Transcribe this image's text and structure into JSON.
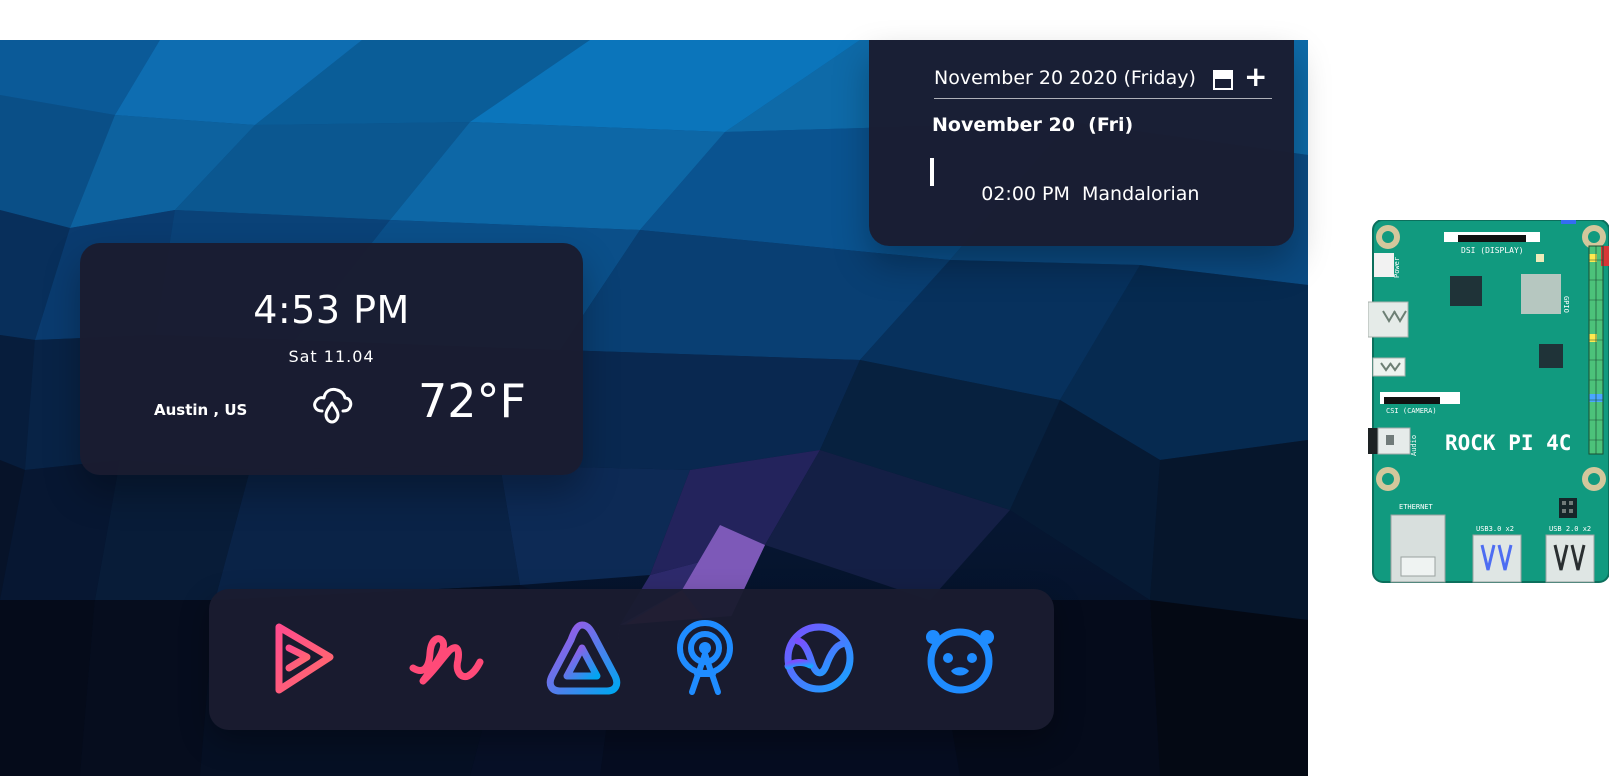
{
  "calendar": {
    "header_title": "November 20 2020 (Friday)",
    "day_heading": "November 20  (Fri)",
    "event_time": "02:00 PM",
    "event_title": "Mandalorian",
    "view_icon": "calendar-view-icon",
    "add_icon": "plus-icon"
  },
  "weather": {
    "time": "4:53 PM",
    "date": "Sat 11.04",
    "location": "Austin , US",
    "temperature": "72°F",
    "condition_icon": "cloud-rain-icon"
  },
  "dock": {
    "apps": [
      {
        "icon": "play-triangle-icon"
      },
      {
        "icon": "wave-script-icon"
      },
      {
        "icon": "triangle-icon"
      },
      {
        "icon": "broadcast-antenna-icon"
      },
      {
        "icon": "v-circle-icon"
      },
      {
        "icon": "bear-face-icon"
      }
    ]
  },
  "board": {
    "title": "ROCK PI 4C",
    "labels": {
      "dsi": "DSI (DISPLAY)",
      "csi": "CSI (CAMERA)",
      "power": "Power",
      "audio": "Audio",
      "gpio": "GPIO",
      "ethernet": "ETHERNET",
      "usb3": "USB3.0 x2",
      "usb2": "USB 2.0 x2"
    },
    "colors": {
      "pcb": "#119a7f",
      "mount": "#d3c79c",
      "usb_blue": "#4d6df2"
    }
  },
  "colors": {
    "card_bg": "#1a1c30",
    "wallpaper_top": "#0d5f9e",
    "wallpaper_bottom": "#050e21",
    "pink": "#ff4f88",
    "purple": "#8a6cff",
    "blue": "#2d8cff"
  }
}
